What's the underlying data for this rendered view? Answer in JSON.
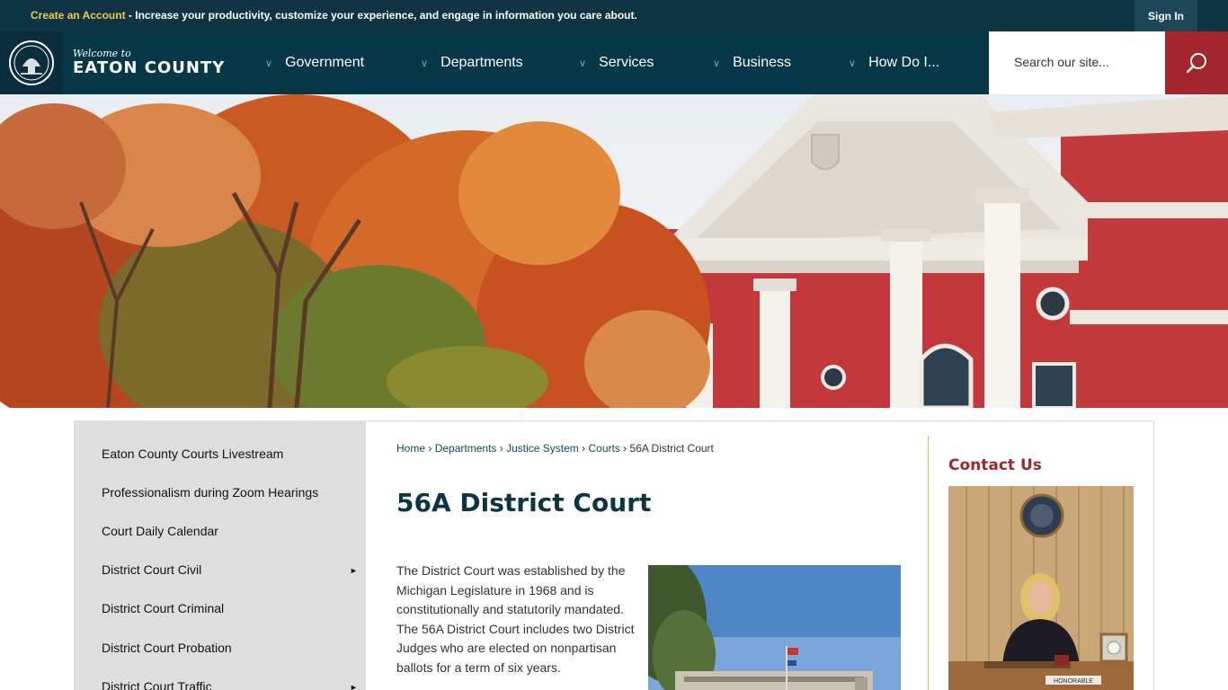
{
  "topbar": {
    "create_account": "Create an Account",
    "promo_text": " - Increase your productivity, customize your experience, and engage in information you care about.",
    "sign_in": "Sign In"
  },
  "header": {
    "welcome": "Welcome to",
    "county_name": "EATON COUNTY",
    "nav": [
      {
        "label": "Government"
      },
      {
        "label": "Departments"
      },
      {
        "label": "Services"
      },
      {
        "label": "Business"
      },
      {
        "label": "How Do I..."
      }
    ],
    "search_placeholder": "Search our site...",
    "search_icon": "search-icon"
  },
  "sidebar": {
    "items": [
      {
        "label": "Eaton County Courts Livestream",
        "has_submenu": false
      },
      {
        "label": "Professionalism during Zoom Hearings",
        "has_submenu": false
      },
      {
        "label": "Court Daily Calendar",
        "has_submenu": false
      },
      {
        "label": "District Court Civil",
        "has_submenu": true
      },
      {
        "label": "District Court Criminal",
        "has_submenu": false
      },
      {
        "label": "District Court Probation",
        "has_submenu": false
      },
      {
        "label": "District Court Traffic",
        "has_submenu": true
      }
    ]
  },
  "breadcrumb": {
    "items": [
      "Home",
      "Departments",
      "Justice System",
      "Courts"
    ],
    "current": "56A District Court",
    "separator": "›"
  },
  "main": {
    "title": "56A District Court",
    "paragraph": "The District Court was established by the Michigan Legislature in 1968 and is constitutionally and statutorily mandated. The 56A District Court includes two District Judges who are elected on nonpartisan ballots for a term of six years."
  },
  "contact": {
    "title": "Contact Us",
    "nameplate": "HONORABLE"
  },
  "colors": {
    "topbar": "#0f3444",
    "header": "#063848",
    "accent_red": "#a3262f",
    "accent_gold": "#f2c94c",
    "title_navy": "#0c3546",
    "sidebar_gray": "#dedede"
  }
}
